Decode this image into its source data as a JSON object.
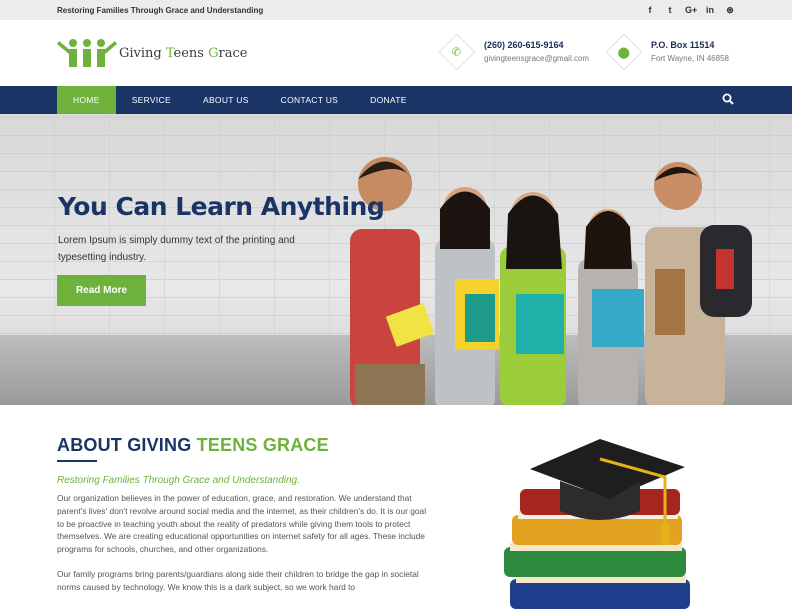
{
  "topbar": {
    "tagline": "Restoring Families Through Grace and Understanding",
    "social": [
      {
        "icon": "facebook-icon",
        "glyph": "f"
      },
      {
        "icon": "twitter-icon",
        "glyph": "t"
      },
      {
        "icon": "google-plus-icon",
        "glyph": "G+"
      },
      {
        "icon": "linkedin-icon",
        "glyph": "in"
      },
      {
        "icon": "dribbble-icon",
        "glyph": "⊛"
      }
    ]
  },
  "header": {
    "logo_text_1": "Giving ",
    "logo_text_2": "T",
    "logo_text_3": "eens ",
    "logo_text_4": "G",
    "logo_text_5": "race",
    "phone": "(260) 260-615-9164",
    "email": "givingteensgrace@gmail.com",
    "po_box": "P.O. Box 11514",
    "city": "Fort Wayne, IN 46858"
  },
  "nav": {
    "items": [
      "HOME",
      "SERVICE",
      "ABOUT US",
      "CONTACT US",
      "DONATE"
    ]
  },
  "hero": {
    "title": "You Can Learn Anything",
    "text": "Lorem Ipsum is simply dummy text of the printing and typesetting industry.",
    "button": "Read More"
  },
  "about": {
    "title_1": "ABOUT GIVING ",
    "title_2": "TEENS GRACE",
    "lead": "Restoring Families Through Grace and Understanding.",
    "para1": "Our organization believes in the power of education, grace, and restoration. We understand that parent's lives' don't revolve around social media and the internet, as their children's do. It is our goal to be proactive in teaching youth about the reality of predators while giving them tools to protect themselves. We are creating educational opportunities on internet safety for all ages. These include programs for schools, churches, and other organizations.",
    "para2": "Our family programs bring parents/guardians along side their children to bridge the gap in societal norms caused by technology. We know this is a dark subject, so we work hard to"
  },
  "colors": {
    "brand_navy": "#1b3466",
    "brand_green": "#6fb23b"
  }
}
